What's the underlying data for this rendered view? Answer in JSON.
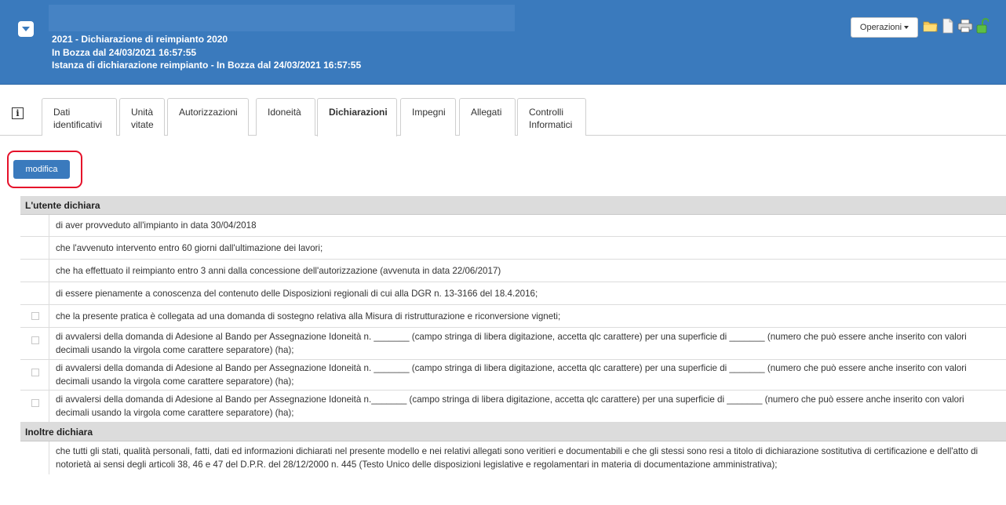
{
  "header": {
    "title": "2021 - Dichiarazione di reimpianto 2020",
    "subtitle": "In Bozza dal 24/03/2021 16:57:55",
    "detail": "Istanza di dichiarazione reimpianto - In Bozza dal 24/03/2021 16:57:55",
    "operations_label": "Operazioni",
    "accent_color": "#3a7abd"
  },
  "tabs": [
    {
      "line1": "Dati",
      "line2": "identificativi"
    },
    {
      "line1": "Unità",
      "line2": "vitate"
    },
    {
      "line1": "Autorizzazioni",
      "line2": ""
    },
    {
      "line1": "Idoneità",
      "line2": ""
    },
    {
      "line1": "Dichiarazioni",
      "line2": ""
    },
    {
      "line1": "Impegni",
      "line2": ""
    },
    {
      "line1": "Allegati",
      "line2": ""
    },
    {
      "line1": "Controlli",
      "line2": "Informatici"
    }
  ],
  "active_tab": "Dichiarazioni",
  "modifica_label": "modifica",
  "sections": {
    "user_declares": "L'utente dichiara",
    "also_declares": "Inoltre dichiara"
  },
  "declarations": [
    "di aver provveduto all'impianto in data 30/04/2018",
    "che l'avvenuto intervento entro 60 giorni dall'ultimazione dei lavori;",
    "che ha effettuato il reimpianto entro 3 anni dalla concessione dell'autorizzazione (avvenuta in data 22/06/2017)",
    "di essere pienamente a conoscenza del contenuto delle Disposizioni regionali di cui alla DGR n. 13-3166 del 18.4.2016;",
    "che la presente pratica è collegata ad una domanda di sostegno relativa alla Misura di ristrutturazione e riconversione vigneti;",
    "di avvalersi della domanda di Adesione al Bando per Assegnazione Idoneità n. _______ (campo stringa di libera digitazione, accetta qlc carattere) per una superficie di _______ (numero che può essere anche inserito con valori decimali usando la virgola come carattere separatore) (ha);",
    "di avvalersi della domanda di Adesione al Bando per Assegnazione Idoneità n. _______ (campo stringa di libera digitazione, accetta qlc carattere) per una superficie di _______ (numero che può essere anche inserito con valori decimali usando la virgola come carattere separatore) (ha);",
    "di avvalersi della domanda di Adesione al Bando per Assegnazione Idoneità n._______ (campo stringa di libera digitazione, accetta qlc carattere) per una superficie di _______ (numero che può essere anche inserito con valori decimali usando la virgola come carattere separatore) (ha);"
  ],
  "also_declarations": [
    "che tutti gli stati, qualità personali, fatti, dati ed informazioni dichiarati nel presente modello e nei relativi allegati sono veritieri e documentabili e che gli stessi sono resi a titolo di dichiarazione sostitutiva di certificazione e dell'atto di notorietà ai sensi degli articoli 38, 46 e 47 del D.P.R. del 28/12/2000 n. 445 (Testo Unico delle disposizioni legislative e regolamentari in materia di documentazione amministrativa);"
  ]
}
